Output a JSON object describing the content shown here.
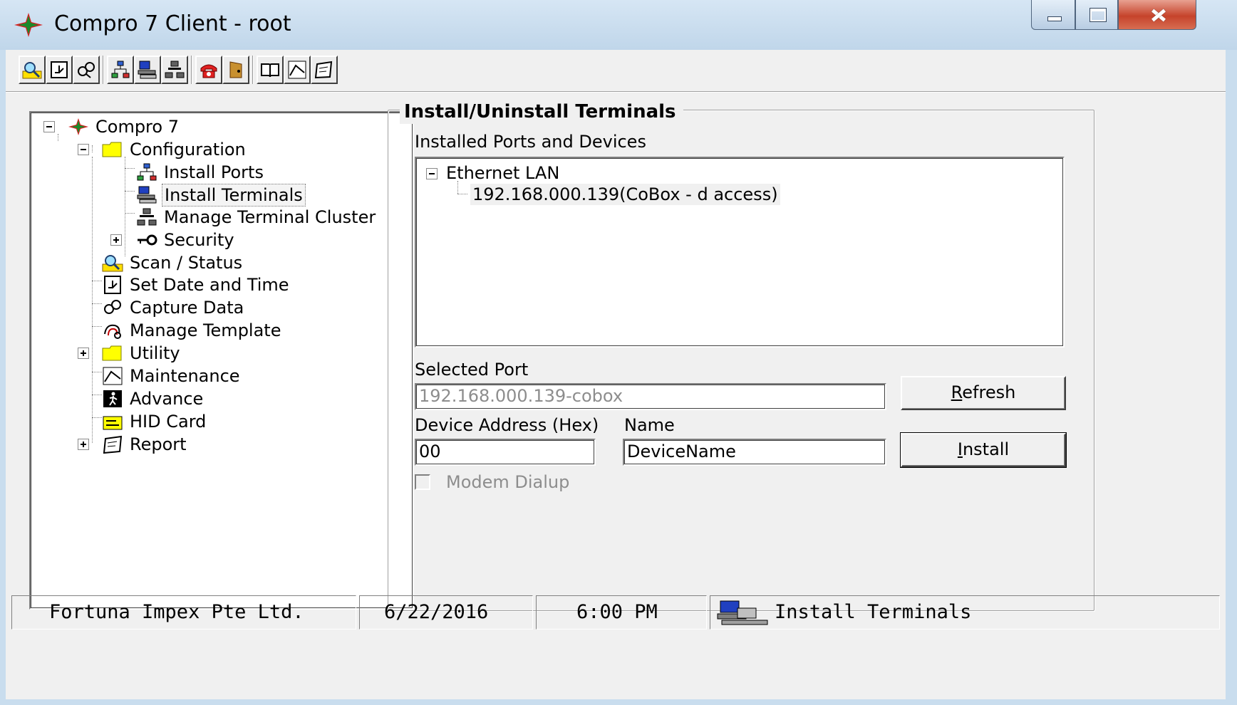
{
  "window": {
    "title": "Compro 7 Client - root"
  },
  "toolbar": {
    "buttons": [
      {
        "icon": "scan-status-icon"
      },
      {
        "icon": "set-date-time-icon"
      },
      {
        "icon": "capture-data-icon"
      },
      {
        "icon": "install-ports-icon"
      },
      {
        "icon": "install-terminals-icon"
      },
      {
        "icon": "manage-terminal-cluster-icon"
      },
      {
        "icon": "modem-phone-icon"
      },
      {
        "icon": "access-door-icon"
      },
      {
        "icon": "book-help-icon"
      },
      {
        "icon": "maintenance-icon"
      },
      {
        "icon": "report-icon"
      }
    ]
  },
  "tree": {
    "root": "Compro 7",
    "configuration": "Configuration",
    "install_ports": "Install Ports",
    "install_terminals": "Install Terminals",
    "manage_terminal_cluster": "Manage Terminal Cluster",
    "security": "Security",
    "scan_status": "Scan / Status",
    "set_date_time": "Set Date and Time",
    "capture_data": "Capture Data",
    "manage_template": "Manage Template",
    "utility": "Utility",
    "maintenance": "Maintenance",
    "advance": "Advance",
    "hid_card": "HID Card",
    "report": "Report",
    "selected": "Install Terminals"
  },
  "panel": {
    "title": "Install/Uninstall Terminals",
    "installed_label": "Installed Ports and Devices",
    "ports_tree": {
      "port": "Ethernet LAN",
      "device": "192.168.000.139(CoBox - d access)"
    },
    "selected_port_label": "Selected Port",
    "selected_port_value": "192.168.000.139-cobox",
    "refresh_button": {
      "accel": "R",
      "rest": "efresh"
    },
    "device_address_label": "Device Address (Hex)",
    "device_address_value": "00",
    "name_label": "Name",
    "name_value": "DeviceName",
    "install_button": {
      "accel": "I",
      "rest": "nstall"
    },
    "modem_dialup_label": "Modem Dialup",
    "modem_dialup_checked": false,
    "modem_dialup_enabled": false
  },
  "statusbar": {
    "company": "Fortuna Impex Pte Ltd.",
    "date": "6/22/2016",
    "time": "6:00 PM",
    "context": "Install Terminals",
    "context_icon": "install-terminals-icon"
  },
  "colors": {
    "title_gradient_top": "#d6e6f4",
    "close_button": "#c6432b",
    "face": "#f0f0f0",
    "folder": "#ffff00"
  }
}
